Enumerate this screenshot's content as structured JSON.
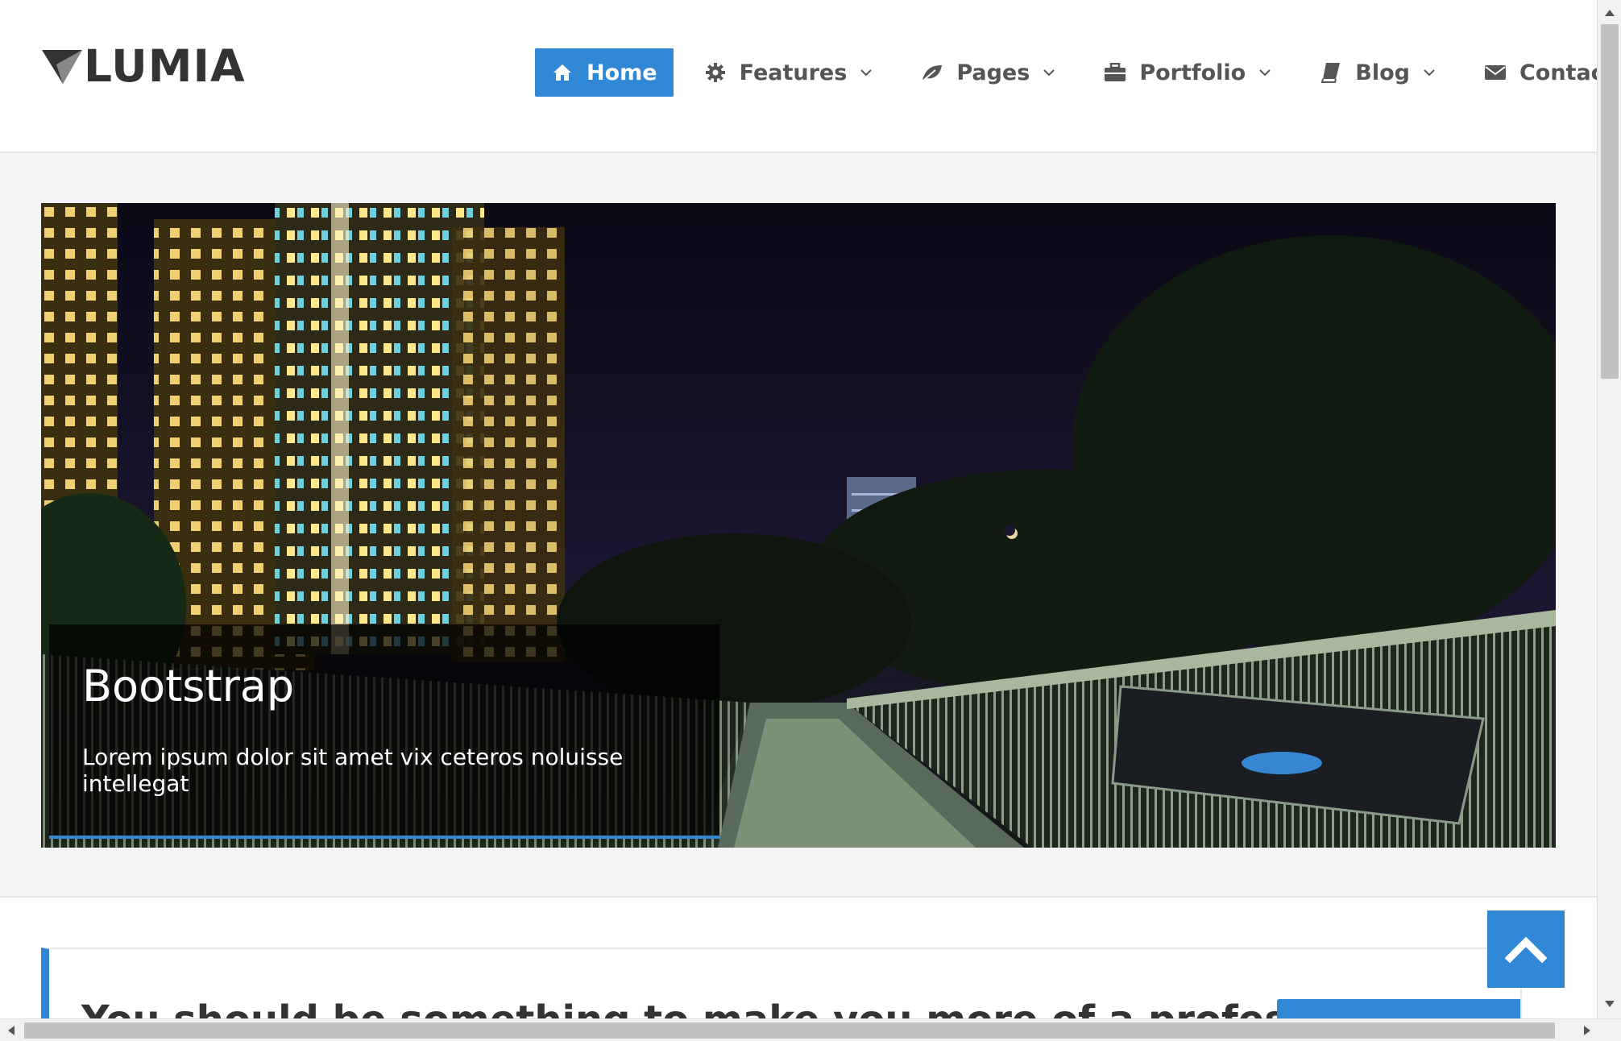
{
  "brand": {
    "name": "LUMIA",
    "logo_icon": "triangle-logo-icon"
  },
  "nav": {
    "items": [
      {
        "label": "Home",
        "icon": "home-icon",
        "active": true,
        "dropdown": false
      },
      {
        "label": "Features",
        "icon": "gear-icon",
        "active": false,
        "dropdown": true
      },
      {
        "label": "Pages",
        "icon": "leaf-icon",
        "active": false,
        "dropdown": true
      },
      {
        "label": "Portfolio",
        "icon": "briefcase-icon",
        "active": false,
        "dropdown": true
      },
      {
        "label": "Blog",
        "icon": "book-icon",
        "active": false,
        "dropdown": true
      },
      {
        "label": "Contact",
        "icon": "envelope-icon",
        "active": false,
        "dropdown": false
      }
    ]
  },
  "slider": {
    "caption_title": "Bootstrap",
    "caption_text": "Lorem ipsum dolor sit amet vix ceteros noluisse intellegat"
  },
  "callout": {
    "text": "You should be something to make you more of a professional"
  },
  "colors": {
    "accent": "#2f87d6",
    "header_bg": "#ffffff",
    "page_bg": "#f4f4f4"
  }
}
